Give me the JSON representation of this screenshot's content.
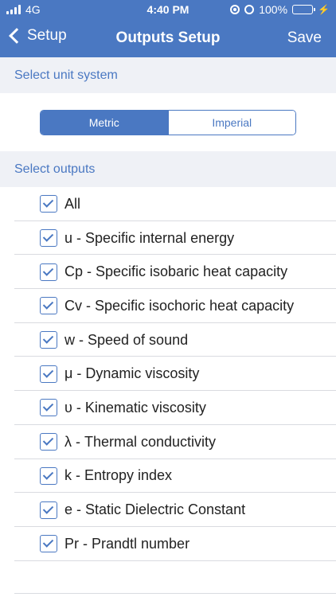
{
  "status_bar": {
    "carrier": "4G",
    "time": "4:40 PM",
    "battery": "100%",
    "icons": [
      "signal-icon",
      "orientation-lock-icon",
      "alarm-icon",
      "battery-icon",
      "charging-icon"
    ],
    "battery_color": "#4cd964"
  },
  "nav": {
    "back_label": "Setup",
    "title": "Outputs Setup",
    "save_label": "Save"
  },
  "colors": {
    "accent": "#4a78c2",
    "section_bg": "#eff1f6"
  },
  "unit_section": {
    "header": "Select unit system",
    "options": [
      "Metric",
      "Imperial"
    ],
    "selected": "Metric"
  },
  "outputs_section": {
    "header": "Select outputs",
    "items": [
      {
        "label": "All",
        "checked": true
      },
      {
        "label": "u - Specific internal energy",
        "checked": true
      },
      {
        "label": "Cp - Specific isobaric heat capacity",
        "checked": true
      },
      {
        "label": "Cv - Specific isochoric heat capacity",
        "checked": true
      },
      {
        "label": "w - Speed of sound",
        "checked": true
      },
      {
        "label": "μ - Dynamic viscosity",
        "checked": true
      },
      {
        "label": "υ - Kinematic viscosity",
        "checked": true
      },
      {
        "label": "λ - Thermal conductivity",
        "checked": true
      },
      {
        "label": "k - Entropy index",
        "checked": true
      },
      {
        "label": "e - Static Dielectric Constant",
        "checked": true
      },
      {
        "label": "Pr - Prandtl number",
        "checked": true
      }
    ]
  }
}
